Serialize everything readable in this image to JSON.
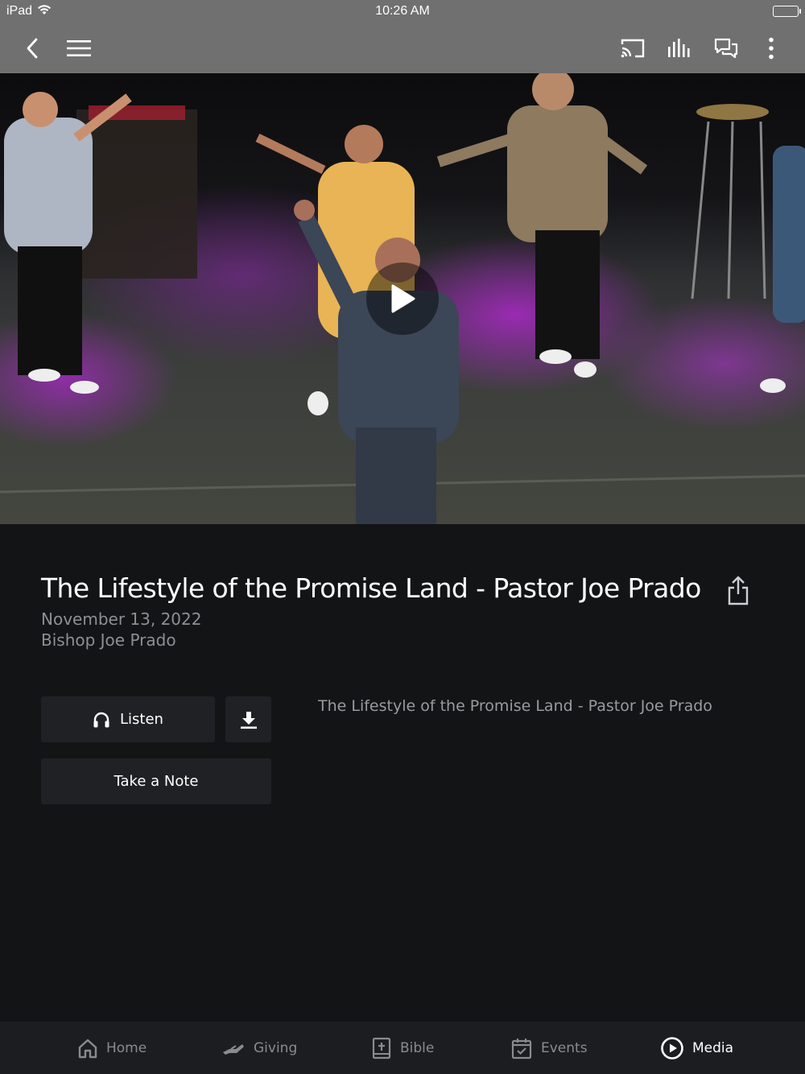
{
  "status_bar": {
    "carrier": "iPad",
    "time": "10:26 AM"
  },
  "nav_bar": {
    "icons": [
      "back-icon",
      "menu-icon",
      "cast-icon",
      "audio-bars-icon",
      "chat-icon",
      "more-icon"
    ]
  },
  "video": {
    "play_icon": "play-icon"
  },
  "sermon": {
    "title": "The Lifestyle of the Promise Land - Pastor Joe Prado",
    "date": "November 13, 2022",
    "author": "Bishop Joe Prado",
    "description": "The Lifestyle of the Promise Land - Pastor Joe Prado"
  },
  "actions": {
    "listen_label": "Listen",
    "note_label": "Take a Note"
  },
  "tab_bar": {
    "tabs": [
      {
        "label": "Home",
        "icon": "home-icon",
        "active": false
      },
      {
        "label": "Giving",
        "icon": "giving-icon",
        "active": false
      },
      {
        "label": "Bible",
        "icon": "bible-icon",
        "active": false
      },
      {
        "label": "Events",
        "icon": "calendar-icon",
        "active": false
      },
      {
        "label": "Media",
        "icon": "media-play-icon",
        "active": true
      }
    ]
  },
  "colors": {
    "background": "#131416",
    "header": "#707070",
    "button": "#202124",
    "secondary_text": "#8e8f93"
  }
}
